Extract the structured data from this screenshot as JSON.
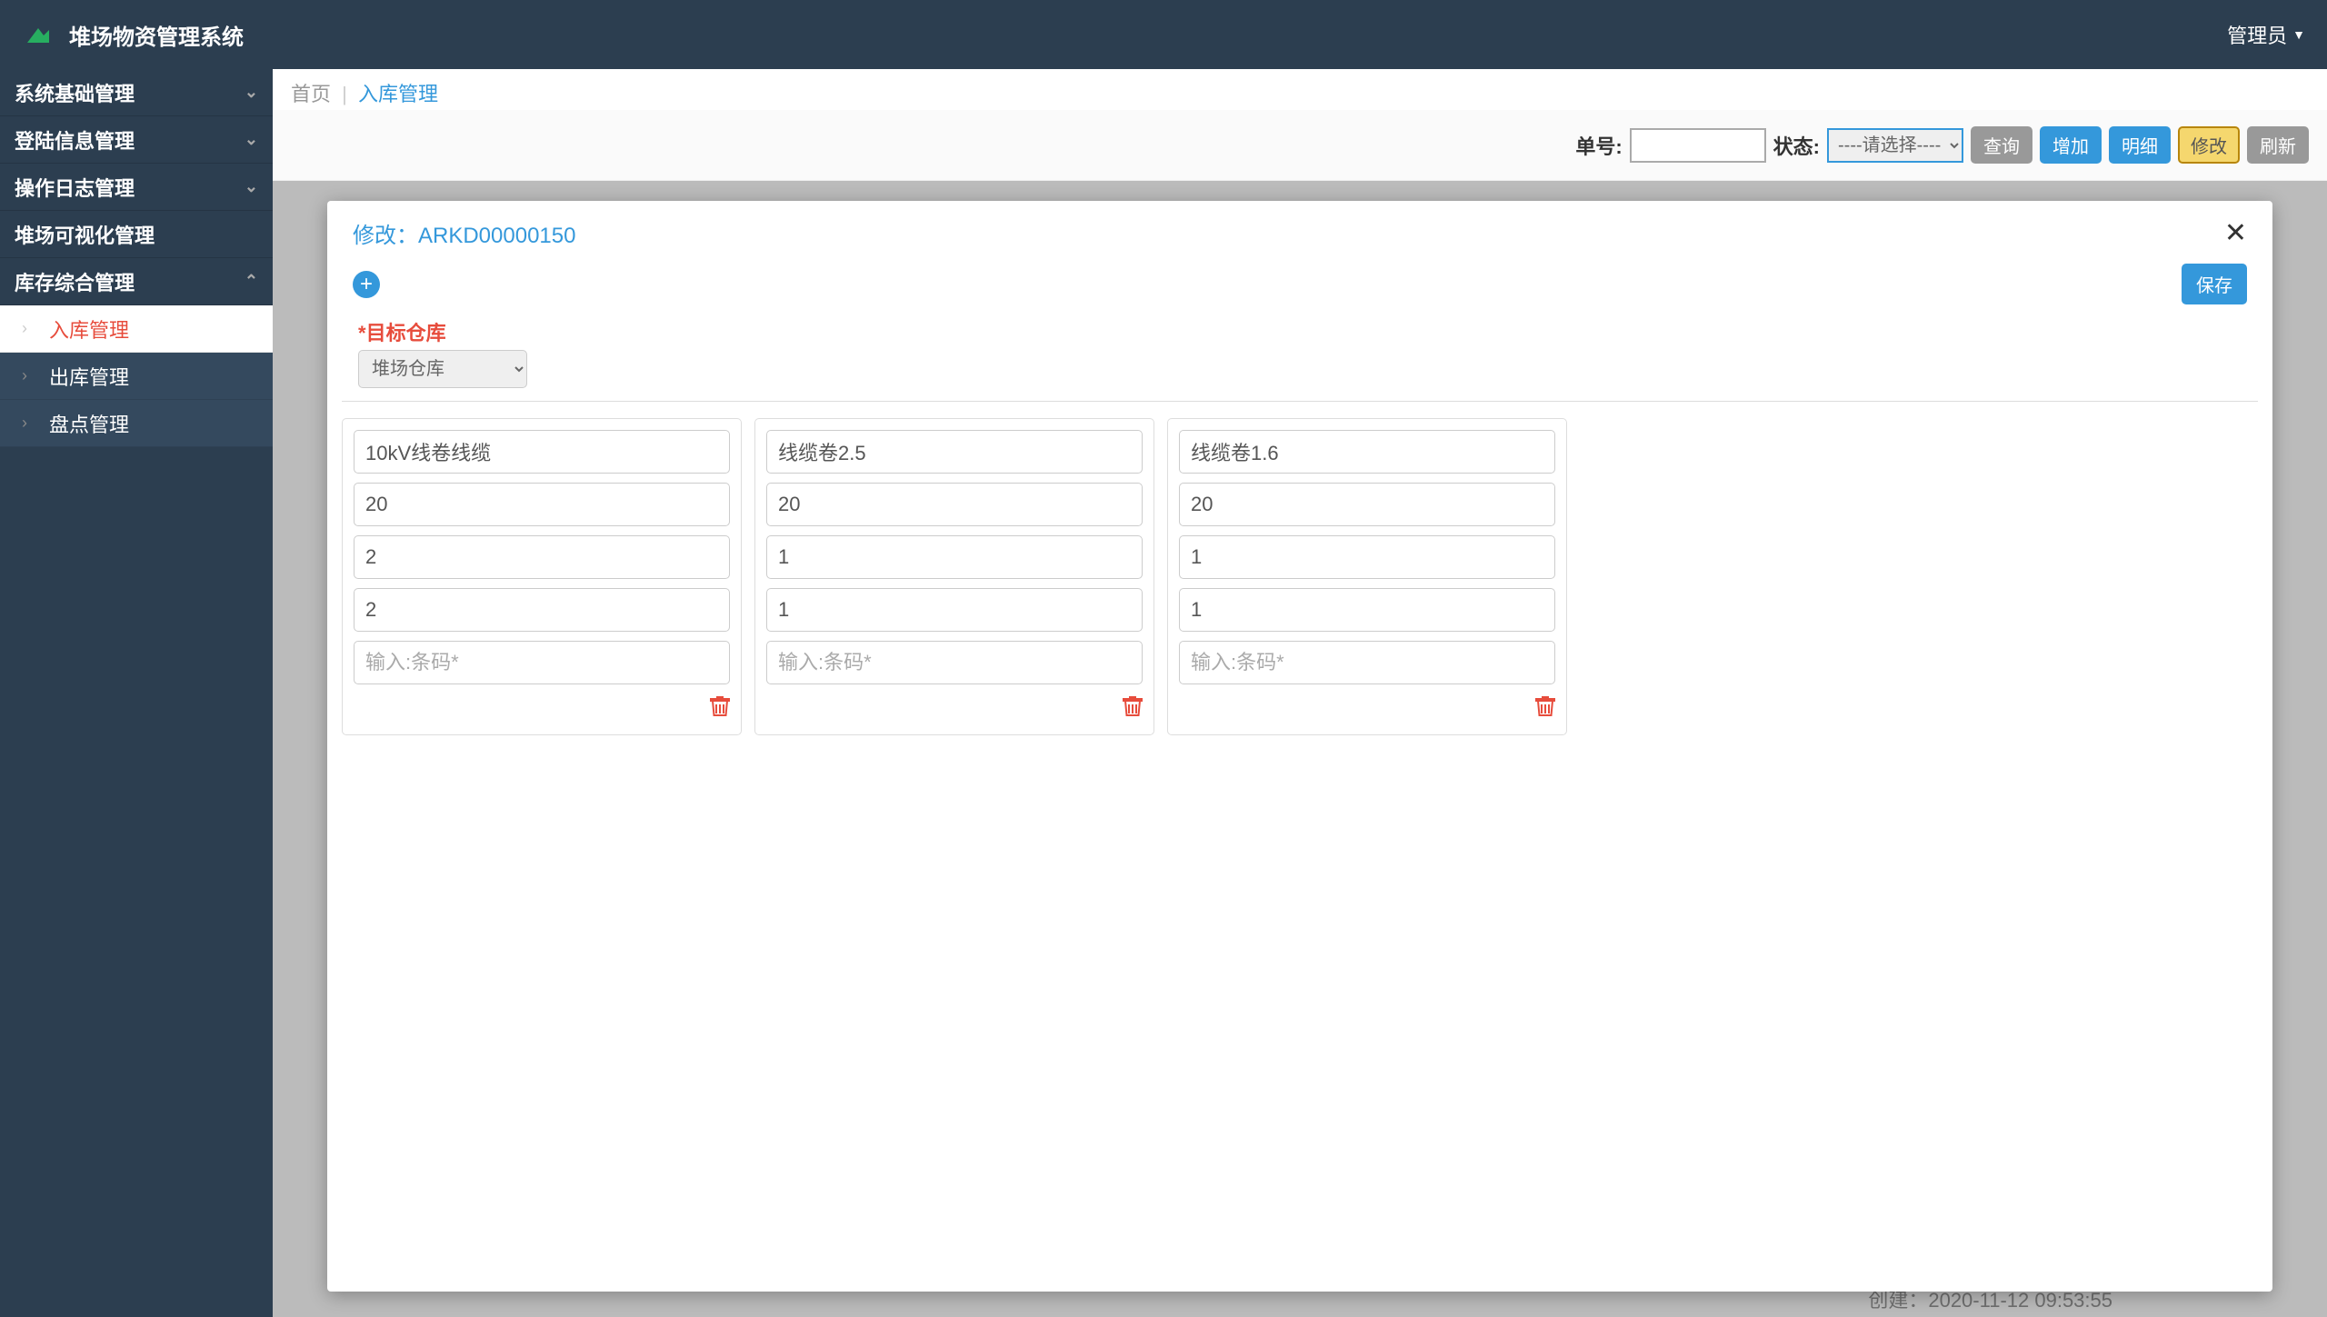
{
  "header": {
    "app_title": "堆场物资管理系统",
    "user_label": "管理员"
  },
  "sidebar": {
    "items": [
      {
        "label": "系统基础管理",
        "chevron": "down"
      },
      {
        "label": "登陆信息管理",
        "chevron": "down"
      },
      {
        "label": "操作日志管理",
        "chevron": "down"
      },
      {
        "label": "堆场可视化管理",
        "chevron": ""
      },
      {
        "label": "库存综合管理",
        "chevron": "up"
      }
    ],
    "sub_items": [
      {
        "label": "入库管理",
        "active": true
      },
      {
        "label": "出库管理",
        "active": false
      },
      {
        "label": "盘点管理",
        "active": false
      }
    ]
  },
  "breadcrumb": {
    "home": "首页",
    "current": "入库管理"
  },
  "toolbar": {
    "order_label": "单号:",
    "status_label": "状态:",
    "status_placeholder": "----请选择----",
    "btn_query": "查询",
    "btn_add": "增加",
    "btn_detail": "明细",
    "btn_edit": "修改",
    "btn_refresh": "刷新"
  },
  "modal": {
    "title_prefix": "修改：",
    "record_id": "ARKD00000150",
    "save_label": "保存",
    "target_label": "目标仓库",
    "target_value": "堆场仓库",
    "barcode_placeholder": "输入:条码*",
    "items": [
      {
        "name": "10kV线卷线缆",
        "field2": "20",
        "field3": "2",
        "field4": "2"
      },
      {
        "name": "线缆卷2.5",
        "field2": "20",
        "field3": "1",
        "field4": "1"
      },
      {
        "name": "线缆卷1.6",
        "field2": "20",
        "field3": "1",
        "field4": "1"
      }
    ]
  },
  "bg": {
    "bottom_text": "创建：2020-11-12 09:53:55"
  }
}
